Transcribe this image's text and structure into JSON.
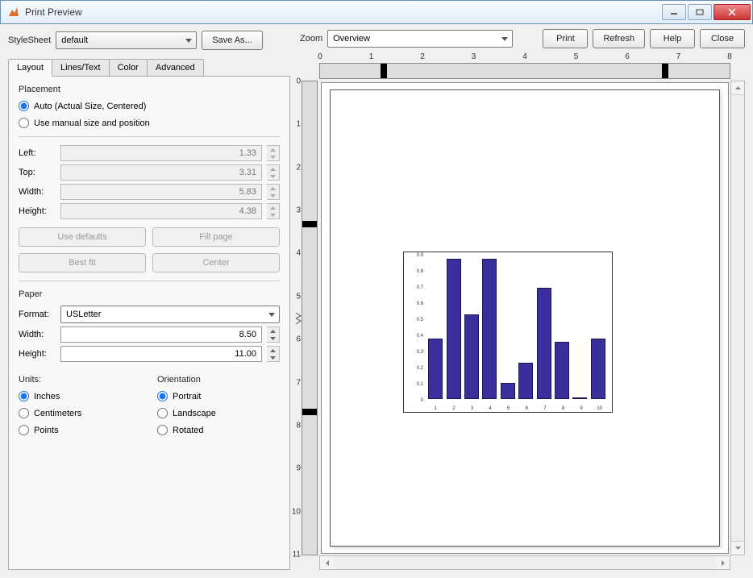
{
  "window": {
    "title": "Print Preview"
  },
  "stylesheet": {
    "label": "StyleSheet",
    "value": "default",
    "save_as": "Save As..."
  },
  "tabs": {
    "layout": "Layout",
    "lines": "Lines/Text",
    "color": "Color",
    "advanced": "Advanced"
  },
  "placement": {
    "label": "Placement",
    "auto": "Auto (Actual Size, Centered)",
    "manual": "Use manual size and position",
    "left_label": "Left:",
    "left": "1.33",
    "top_label": "Top:",
    "top": "3.31",
    "width_label": "Width:",
    "width": "5.83",
    "height_label": "Height:",
    "height": "4.38",
    "use_defaults": "Use defaults",
    "fill_page": "Fill page",
    "best_fit": "Best fit",
    "center": "Center"
  },
  "paper": {
    "label": "Paper",
    "format_label": "Format:",
    "format": "USLetter",
    "width_label": "Width:",
    "width": "8.50",
    "height_label": "Height:",
    "height": "11.00"
  },
  "units": {
    "label": "Units:",
    "inches": "Inches",
    "centimeters": "Centimeters",
    "points": "Points"
  },
  "orientation": {
    "label": "Orientation",
    "portrait": "Portrait",
    "landscape": "Landscape",
    "rotated": "Rotated"
  },
  "zoom": {
    "label": "Zoom",
    "value": "Overview"
  },
  "buttons": {
    "print": "Print",
    "refresh": "Refresh",
    "help": "Help",
    "close": "Close"
  },
  "ruler": {
    "h": [
      "0",
      "1",
      "2",
      "3",
      "4",
      "5",
      "6",
      "7",
      "8"
    ],
    "v": [
      "0",
      "1",
      "2",
      "3",
      "4",
      "5",
      "6",
      "7",
      "8",
      "9",
      "10",
      "11"
    ]
  },
  "chart_data": {
    "type": "bar",
    "categories": [
      "1",
      "2",
      "3",
      "4",
      "5",
      "6",
      "7",
      "8",
      "9",
      "10"
    ],
    "values": [
      0.38,
      0.88,
      0.53,
      0.88,
      0.1,
      0.23,
      0.7,
      0.36,
      0.0,
      0.38
    ],
    "yticks": [
      "0",
      "0.1",
      "0.2",
      "0.3",
      "0.4",
      "0.5",
      "0.6",
      "0.7",
      "0.8",
      "0.9"
    ],
    "ylim": [
      0,
      0.9
    ]
  }
}
